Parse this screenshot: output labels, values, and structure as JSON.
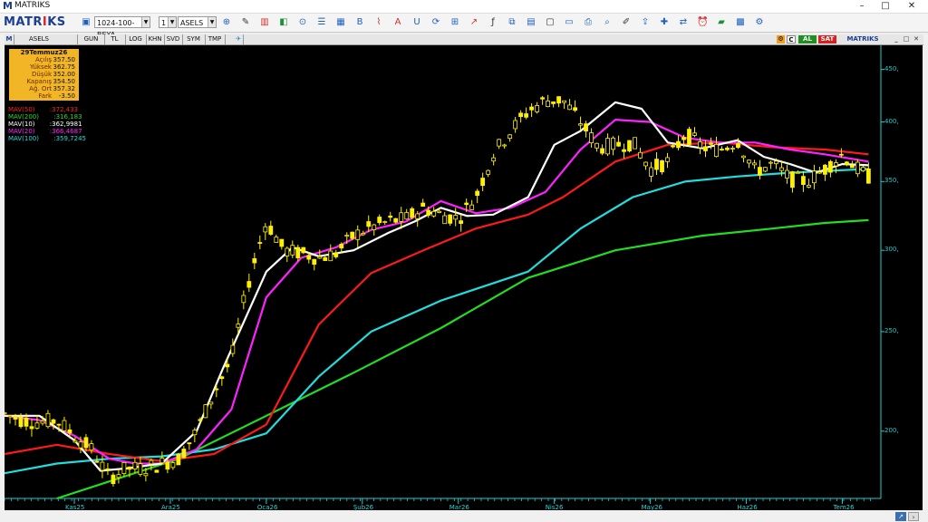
{
  "window": {
    "title": "MATRIKS",
    "minimize": "–",
    "maximize": "□",
    "close": "✕"
  },
  "toolbar": {
    "brand_a": "MATR",
    "brand_x": "I",
    "brand_b": "KS",
    "template_value": "1024-100-BEYA",
    "layout_value": "1",
    "symbol_value": "ASELS",
    "icons": [
      "save-icon",
      "zoom-icon",
      "draw-icon",
      "chart-type-icon",
      "color-icon",
      "indicator-icon",
      "list-icon",
      "layout-icon",
      "bold-icon",
      "chart-icon",
      "text-icon",
      "undo-icon",
      "refresh-icon",
      "grid-icon",
      "trend-icon",
      "formula-icon",
      "template-icon",
      "table-icon",
      "calendar-icon",
      "folder-icon",
      "print-icon",
      "search-icon",
      "edit-icon",
      "export-icon",
      "crosshair-icon",
      "compare-icon",
      "alarm-icon",
      "news-icon",
      "calc-icon",
      "settings-icon"
    ]
  },
  "chart_tabs": {
    "symbol": "ASELS",
    "items": [
      "GUN",
      "TL",
      "LOG",
      "KHN",
      "SVD",
      "SYM",
      "TMP"
    ],
    "al": "AL",
    "sat": "SAT",
    "c": "C",
    "brand": "MATRIKS"
  },
  "infobox": {
    "date": "29Temmuz26",
    "rows": [
      {
        "label": "Açılış",
        "value": "357.50"
      },
      {
        "label": "Yüksek",
        "value": "362.75"
      },
      {
        "label": "Düşük",
        "value": "352.00"
      },
      {
        "label": "Kapanış",
        "value": "354.50"
      },
      {
        "label": "Ağ. Ort",
        "value": "357.32"
      },
      {
        "label": "Fark",
        "value": "-3.50"
      }
    ]
  },
  "colors": {
    "candle": "#ffef00",
    "mav50": "#ff1a1a",
    "mav200": "#22dd22",
    "mav10": "#ffffff",
    "mav20": "#ff22ff",
    "mav100": "#22dddd",
    "axis": "#1ccfcf"
  },
  "legend": [
    {
      "name": "MAV(50)",
      "value": ":372,433",
      "color": "#ff2020"
    },
    {
      "name": "MAV(200)",
      "value": ":316,183",
      "color": "#22dd22"
    },
    {
      "name": "MAV(10)",
      "value": ":362,9981",
      "color": "#ffffff"
    },
    {
      "name": "MAV(20)",
      "value": ":366,4687",
      "color": "#ff22ff"
    },
    {
      "name": "MAV(100)",
      "value": ":359,7245",
      "color": "#22dddd"
    }
  ],
  "chart_data": {
    "type": "line",
    "scale": "log",
    "ylim": [
      172,
      475
    ],
    "yticks": [
      200,
      250,
      300,
      350,
      400,
      450
    ],
    "ytick_labels": [
      "200,",
      "250,",
      "300,",
      "350,",
      "400,",
      "450,"
    ],
    "xticks": [
      "Kas25",
      "Ara25",
      "Oca26",
      "Şub26",
      "Mar26",
      "Nis26",
      "May26",
      "Haz26",
      "Tem26"
    ],
    "series": [
      {
        "name": "MAV(200)",
        "color": "#22dd22",
        "x": [
          0.06,
          0.2,
          0.3,
          0.4,
          0.5,
          0.6,
          0.7,
          0.8,
          0.88,
          0.94,
          0.99
        ],
        "y": [
          172,
          188,
          207,
          228,
          252,
          282,
          300,
          310,
          315,
          319,
          321
        ]
      },
      {
        "name": "MAV(100)",
        "color": "#22dddd",
        "x": [
          0,
          0.06,
          0.12,
          0.18,
          0.24,
          0.3,
          0.36,
          0.42,
          0.5,
          0.6,
          0.66,
          0.72,
          0.78,
          0.84,
          0.9,
          0.96,
          0.99
        ],
        "y": [
          182,
          186,
          188,
          189,
          192,
          199,
          226,
          250,
          268,
          286,
          315,
          338,
          350,
          354,
          357,
          359,
          360
        ]
      },
      {
        "name": "MAV(50)",
        "color": "#ff1a1a",
        "x": [
          0,
          0.06,
          0.12,
          0.18,
          0.24,
          0.3,
          0.36,
          0.42,
          0.48,
          0.54,
          0.6,
          0.64,
          0.7,
          0.76,
          0.82,
          0.88,
          0.94,
          0.99
        ],
        "y": [
          190,
          194,
          190,
          187,
          190,
          203,
          254,
          285,
          300,
          315,
          325,
          338,
          366,
          380,
          382,
          378,
          376,
          372
        ]
      },
      {
        "name": "MAV(20)",
        "color": "#ff22ff",
        "x": [
          0,
          0.04,
          0.08,
          0.12,
          0.15,
          0.18,
          0.22,
          0.26,
          0.3,
          0.34,
          0.38,
          0.42,
          0.46,
          0.5,
          0.54,
          0.58,
          0.62,
          0.66,
          0.7,
          0.74,
          0.78,
          0.82,
          0.86,
          0.9,
          0.94,
          0.99
        ],
        "y": [
          207,
          205,
          198,
          188,
          186,
          186,
          192,
          210,
          270,
          295,
          302,
          314,
          320,
          335,
          326,
          330,
          342,
          376,
          402,
          400,
          386,
          382,
          382,
          376,
          372,
          366
        ]
      },
      {
        "name": "MAV(10)",
        "color": "#ffffff",
        "x": [
          0,
          0.04,
          0.08,
          0.11,
          0.14,
          0.18,
          0.22,
          0.25,
          0.3,
          0.33,
          0.36,
          0.4,
          0.44,
          0.47,
          0.5,
          0.53,
          0.56,
          0.6,
          0.63,
          0.66,
          0.7,
          0.73,
          0.76,
          0.8,
          0.84,
          0.87,
          0.9,
          0.93,
          0.96,
          0.99
        ],
        "y": [
          207,
          207,
          196,
          183,
          184,
          186,
          200,
          230,
          286,
          302,
          296,
          300,
          312,
          320,
          330,
          324,
          325,
          338,
          380,
          392,
          418,
          412,
          382,
          377,
          384,
          370,
          364,
          357,
          364,
          363
        ]
      },
      {
        "name": "Price",
        "color": "#ffef00",
        "x": [
          0,
          0.02,
          0.04,
          0.06,
          0.08,
          0.1,
          0.12,
          0.14,
          0.16,
          0.18,
          0.2,
          0.22,
          0.24,
          0.26,
          0.28,
          0.3,
          0.32,
          0.34,
          0.36,
          0.38,
          0.4,
          0.42,
          0.44,
          0.46,
          0.48,
          0.5,
          0.52,
          0.54,
          0.56,
          0.58,
          0.6,
          0.62,
          0.64,
          0.66,
          0.68,
          0.7,
          0.72,
          0.74,
          0.76,
          0.78,
          0.8,
          0.82,
          0.84,
          0.86,
          0.88,
          0.9,
          0.92,
          0.94,
          0.96,
          0.98,
          0.99
        ],
        "y": [
          208,
          205,
          204,
          205,
          198,
          192,
          180,
          184,
          184,
          186,
          188,
          200,
          218,
          235,
          280,
          320,
          300,
          298,
          295,
          298,
          310,
          316,
          320,
          322,
          330,
          325,
          322,
          338,
          372,
          392,
          410,
          420,
          420,
          400,
          378,
          380,
          382,
          360,
          366,
          390,
          378,
          376,
          384,
          358,
          364,
          352,
          350,
          360,
          372,
          358,
          354
        ]
      }
    ]
  }
}
